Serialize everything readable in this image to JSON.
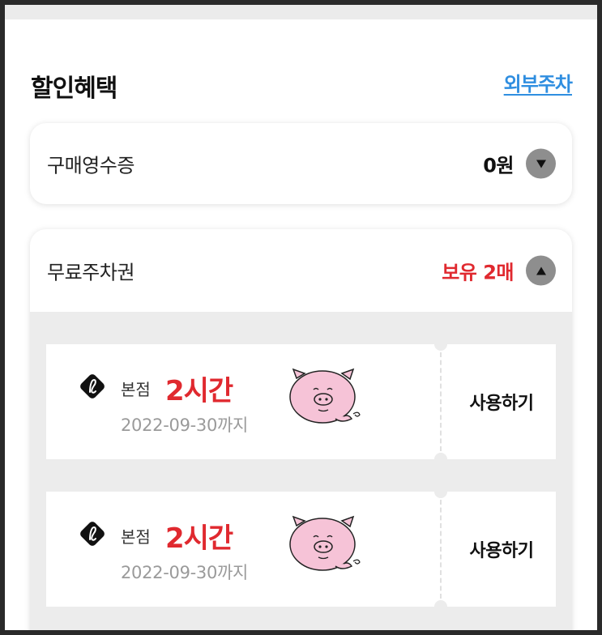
{
  "section": {
    "title": "할인혜택",
    "external_link": "외부주차"
  },
  "receipt": {
    "label": "구매영수증",
    "value": "0원"
  },
  "free_parking": {
    "label": "무료주차권",
    "count": "보유 2매",
    "tickets": [
      {
        "branch": "본점",
        "duration": "2시간",
        "expiry": "2022-09-30까지",
        "action": "사용하기"
      },
      {
        "branch": "본점",
        "duration": "2시간",
        "expiry": "2022-09-30까지",
        "action": "사용하기"
      }
    ]
  },
  "colors": {
    "accent_red": "#e0292f",
    "link_blue": "#2f8ee0",
    "toggle_gray": "#8e8e8e"
  },
  "icons": [
    "caret-down-icon",
    "caret-up-icon",
    "brand-logo-icon",
    "pig-mascot-icon"
  ]
}
